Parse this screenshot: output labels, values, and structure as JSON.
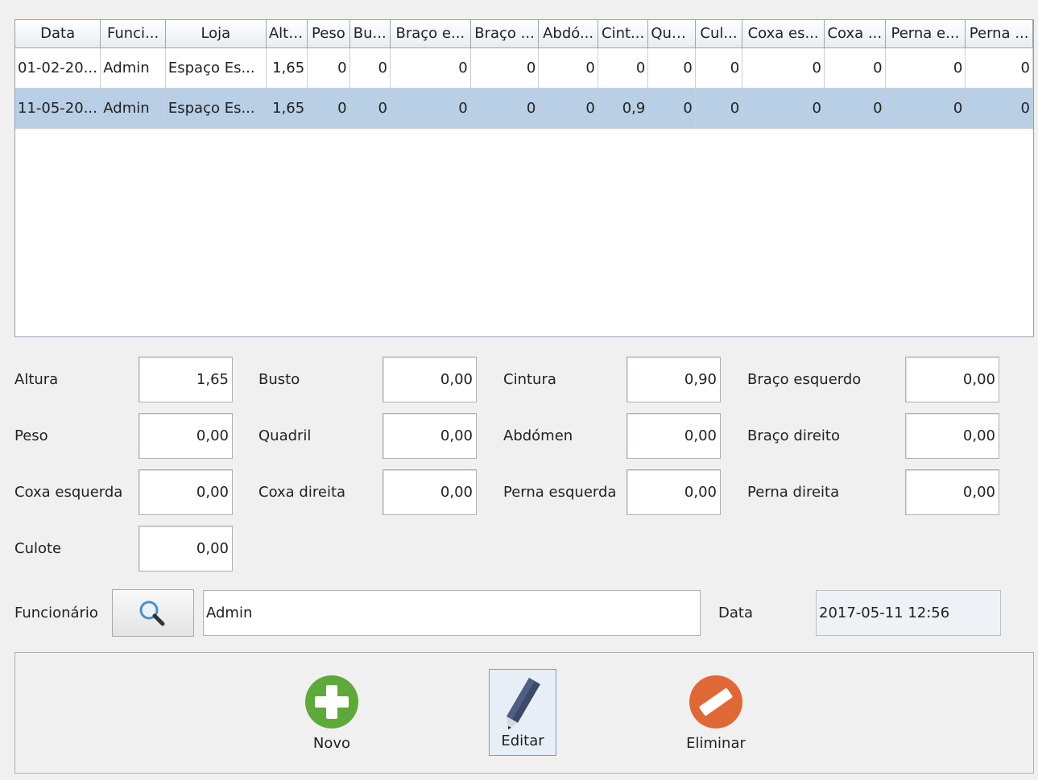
{
  "table": {
    "columns": [
      "Data",
      "Funci...",
      "Loja",
      "Altu...",
      "Peso",
      "Bu...",
      "Braço e...",
      "Braço ...",
      "Abdó...",
      "Cint...",
      "Qua...",
      "Cul...",
      "Coxa es...",
      "Coxa ...",
      "Perna e...",
      "Perna ..."
    ],
    "rows": [
      [
        "01-02-20...",
        "Admin",
        "Espaço Es...",
        "1,65",
        "0",
        "0",
        "0",
        "0",
        "0",
        "0",
        "0",
        "0",
        "0",
        "0",
        "0",
        "0"
      ],
      [
        "11-05-20...",
        "Admin",
        "Espaço Es...",
        "1,65",
        "0",
        "0",
        "0",
        "0",
        "0",
        "0,9",
        "0",
        "0",
        "0",
        "0",
        "0",
        "0"
      ]
    ],
    "selected_row": 1,
    "selection_color": "#b8cfe5"
  },
  "form": {
    "altura": {
      "label": "Altura",
      "value": "1,65"
    },
    "busto": {
      "label": "Busto",
      "value": "0,00"
    },
    "cintura": {
      "label": "Cintura",
      "value": "0,90"
    },
    "braco_esquerdo": {
      "label": "Braço esquerdo",
      "value": "0,00"
    },
    "peso": {
      "label": "Peso",
      "value": "0,00"
    },
    "quadril": {
      "label": "Quadril",
      "value": "0,00"
    },
    "abdomen": {
      "label": "Abdómen",
      "value": "0,00"
    },
    "braco_direito": {
      "label": "Braço direito",
      "value": "0,00"
    },
    "coxa_esquerda": {
      "label": "Coxa esquerda",
      "value": "0,00"
    },
    "coxa_direita": {
      "label": "Coxa direita",
      "value": "0,00"
    },
    "perna_esquerda": {
      "label": "Perna esquerda",
      "value": "0,00"
    },
    "perna_direita": {
      "label": "Perna direita",
      "value": "0,00"
    },
    "culote": {
      "label": "Culote",
      "value": "0,00"
    }
  },
  "funcionario": {
    "label": "Funcionário",
    "value": "Admin",
    "search_icon": "search-icon"
  },
  "data": {
    "label": "Data",
    "value": "2017-05-11 12:56"
  },
  "actions": {
    "novo": {
      "label": "Novo",
      "icon": "plus-icon",
      "color": "#5fa83a"
    },
    "editar": {
      "label": "Editar",
      "icon": "pencil-icon",
      "color": "#3c4a68"
    },
    "eliminar": {
      "label": "Eliminar",
      "icon": "minus-icon",
      "color": "#e06836"
    }
  }
}
